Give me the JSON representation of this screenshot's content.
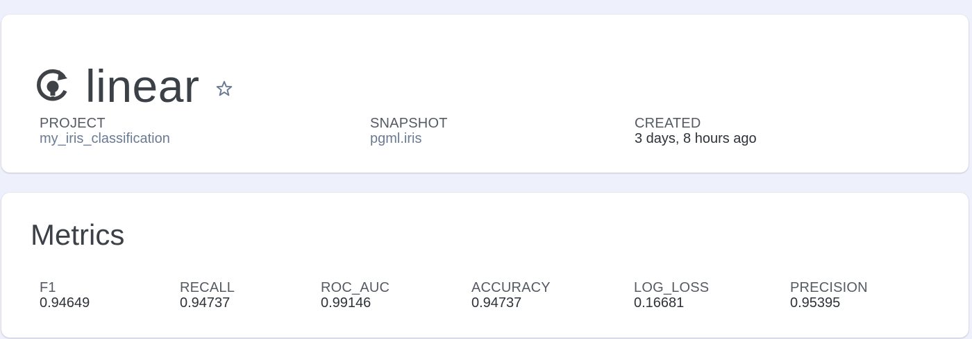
{
  "model": {
    "name": "linear",
    "icon": "model-refresh-lightbulb-icon",
    "star_icon": "star-outline-icon",
    "fields": {
      "project": {
        "label": "PROJECT",
        "value": "my_iris_classification"
      },
      "snapshot": {
        "label": "SNAPSHOT",
        "value": "pgml.iris"
      },
      "created": {
        "label": "CREATED",
        "value": "3 days, 8 hours ago"
      }
    }
  },
  "metrics": {
    "title": "Metrics",
    "items": [
      {
        "label": "F1",
        "value": "0.94649"
      },
      {
        "label": "RECALL",
        "value": "0.94737"
      },
      {
        "label": "ROC_AUC",
        "value": "0.99146"
      },
      {
        "label": "ACCURACY",
        "value": "0.94737"
      },
      {
        "label": "LOG_LOSS",
        "value": "0.16681"
      },
      {
        "label": "PRECISION",
        "value": "0.95395"
      }
    ]
  },
  "colors": {
    "background": "#eef0fb",
    "card": "#ffffff",
    "link": "#6b7a93",
    "text": "#2d3138"
  }
}
